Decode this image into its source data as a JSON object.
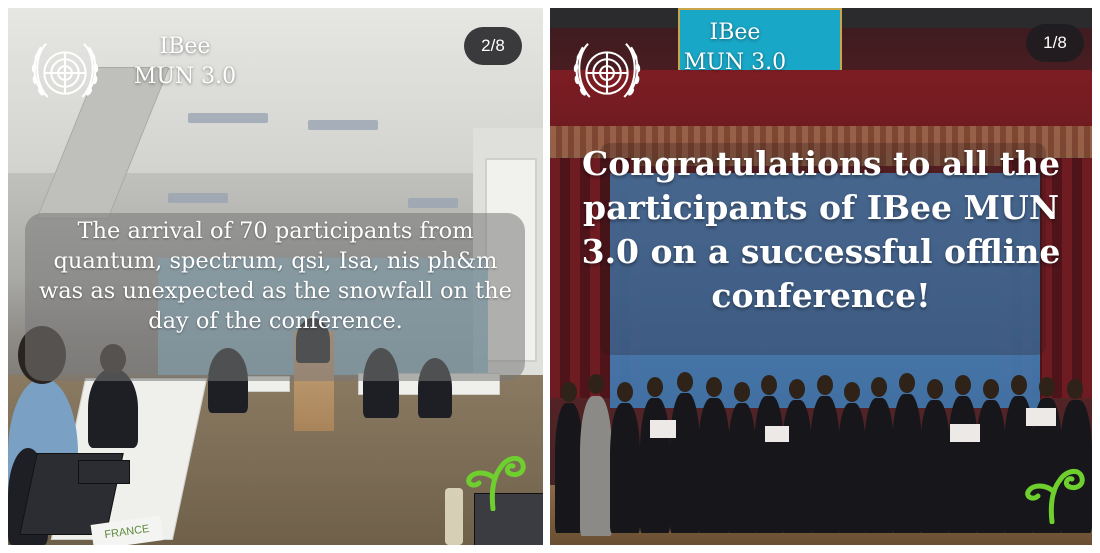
{
  "left_story": {
    "brand": "IBee\nMUN 3.0",
    "counter": "2/8",
    "caption": "The arrival of 70 participants from quantum, spectrum, qsi, Isa, nis ph&m was as unexpected as the snowfall on the day of the conference.",
    "name_sign": "FRANCE",
    "icons": {
      "logo": "un-emblem-icon",
      "sprout": "green-sprout-icon"
    }
  },
  "right_story": {
    "brand": "IBee\nMUN 3.0",
    "counter": "1/8",
    "caption": "Congratulations to all the participants of IBee MUN 3.0 on a successful offline conference!",
    "icons": {
      "logo": "un-emblem-icon",
      "sprout": "green-sprout-icon"
    }
  },
  "colors": {
    "caption_text": "#ffffff",
    "counter_bg": "#1c1c20",
    "sprout_green": "#6fcf2e"
  }
}
